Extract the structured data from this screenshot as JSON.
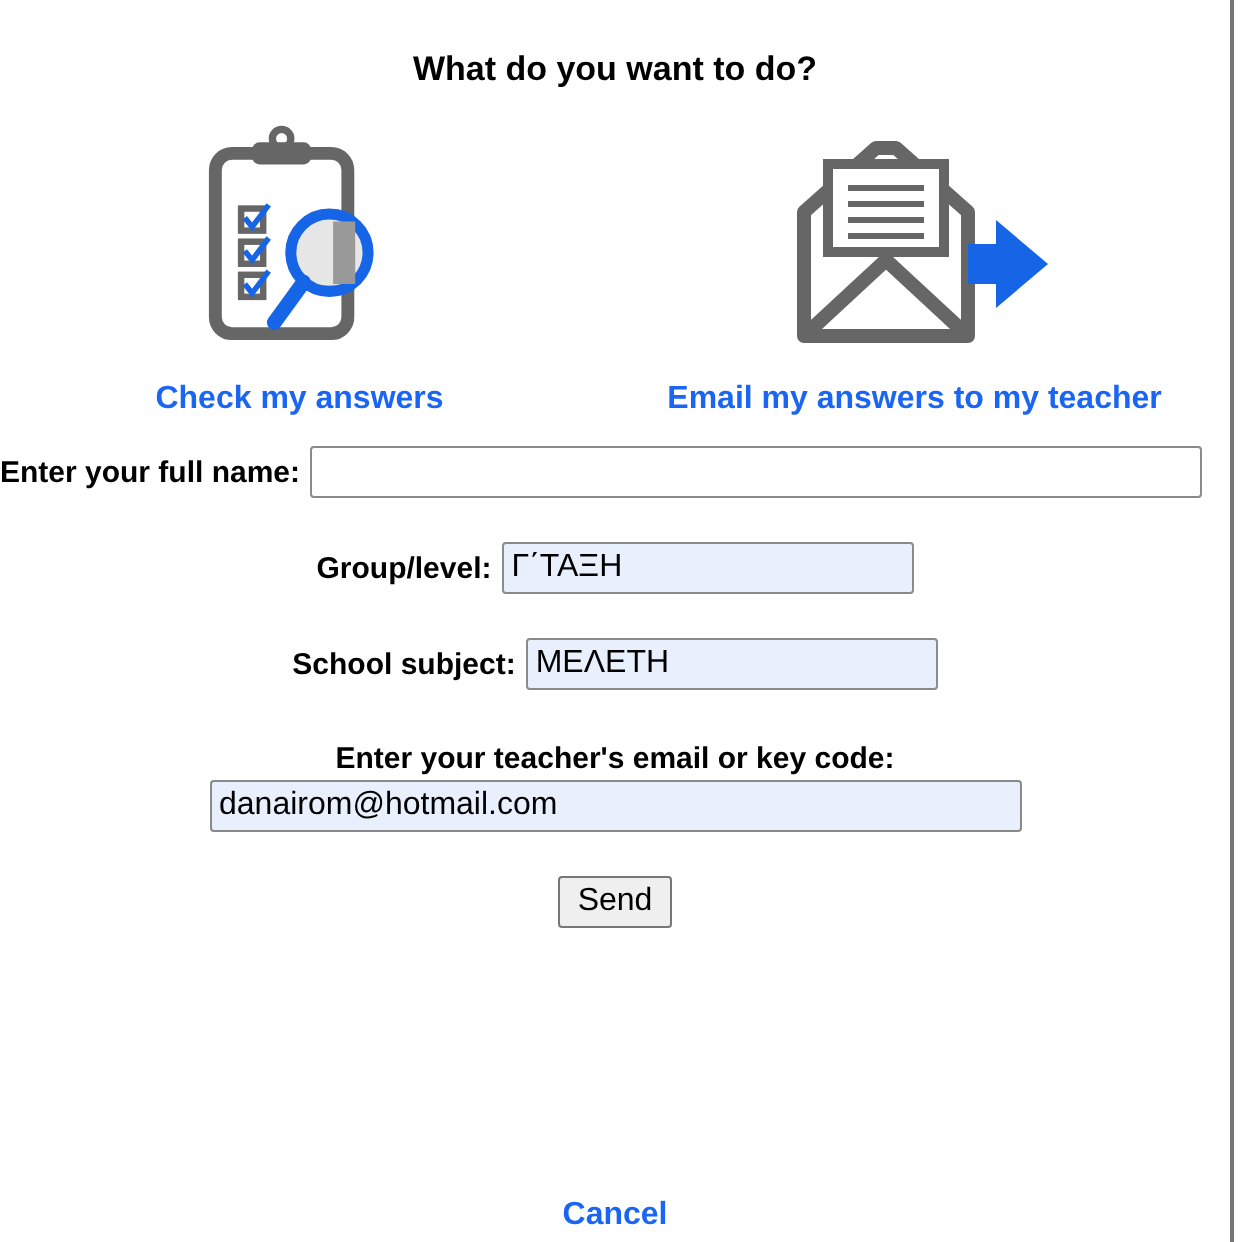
{
  "dialog": {
    "title": "What do you want to do?"
  },
  "options": [
    {
      "kind": "check",
      "label": "Check my answers"
    },
    {
      "kind": "email",
      "label": "Email my answers to my teacher"
    }
  ],
  "fields": [
    {
      "kind": "inline",
      "label": "Enter your full name:",
      "autofilled": false
    },
    {
      "kind": "inline",
      "label": "Group/level:",
      "value": "Γ΄ΤΑΞΗ",
      "autofilled": true
    },
    {
      "kind": "inline",
      "label": "School subject:",
      "value": "ΜΕΛΕΤΗ",
      "autofilled": true
    },
    {
      "kind": "stacked",
      "label": "Enter your teacher's email or key code:",
      "value": "danairom@hotmail.com",
      "autofilled": true
    }
  ],
  "send_button": "Send",
  "cancel_link": "Cancel"
}
